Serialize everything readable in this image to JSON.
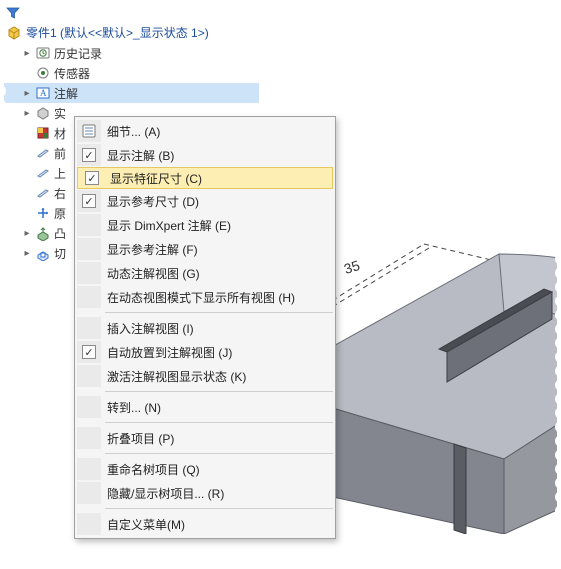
{
  "tree": {
    "root_label": "零件1 (默认<<默认>_显示状态 1>)",
    "items": [
      {
        "label": "历史记录",
        "expander": "▸",
        "icon": "history"
      },
      {
        "label": "传感器",
        "expander": "",
        "icon": "sensor"
      },
      {
        "label": "注解",
        "expander": "▸",
        "icon": "annotation",
        "selected": true
      },
      {
        "label": "实",
        "expander": "▸",
        "icon": "solid"
      },
      {
        "label": "材",
        "expander": "",
        "icon": "material"
      },
      {
        "label": "前",
        "expander": "",
        "icon": "plane"
      },
      {
        "label": "上",
        "expander": "",
        "icon": "plane"
      },
      {
        "label": "右",
        "expander": "",
        "icon": "plane"
      },
      {
        "label": "原",
        "expander": "",
        "icon": "origin"
      },
      {
        "label": "凸",
        "expander": "▸",
        "icon": "extrude"
      },
      {
        "label": "切",
        "expander": "▸",
        "icon": "cut"
      }
    ]
  },
  "menu": {
    "items": [
      {
        "label": "细节... (A)",
        "icon": "detail",
        "checked": false
      },
      {
        "label": "显示注解 (B)",
        "icon": "",
        "checked": true
      },
      {
        "label": "显示特征尺寸 (C)",
        "icon": "",
        "checked": true,
        "highlighted": true
      },
      {
        "label": "显示参考尺寸 (D)",
        "icon": "",
        "checked": true
      },
      {
        "label": "显示 DimXpert 注解 (E)",
        "icon": "",
        "checked": false
      },
      {
        "label": "显示参考注解 (F)",
        "icon": "",
        "checked": false
      },
      {
        "label": "动态注解视图 (G)",
        "icon": "",
        "checked": false
      },
      {
        "label": "在动态视图模式下显示所有视图 (H)",
        "icon": "",
        "checked": false
      },
      {
        "label": "插入注解视图 (I)",
        "icon": "",
        "checked": false,
        "sep_before": true
      },
      {
        "label": "自动放置到注解视图 (J)",
        "icon": "",
        "checked": true
      },
      {
        "label": "激活注解视图显示状态 (K)",
        "icon": "",
        "checked": false
      },
      {
        "label": "转到... (N)",
        "icon": "",
        "checked": false,
        "sep_before": true
      },
      {
        "label": "折叠项目 (P)",
        "icon": "",
        "checked": false,
        "sep_before": true
      },
      {
        "label": "重命名树项目 (Q)",
        "icon": "",
        "checked": false,
        "sep_before": true
      },
      {
        "label": "隐藏/显示树项目... (R)",
        "icon": "",
        "checked": false
      },
      {
        "label": "自定义菜单(M)",
        "icon": "",
        "checked": false,
        "sep_before": true
      }
    ]
  },
  "dimension": {
    "value": "35"
  },
  "watermark": ""
}
